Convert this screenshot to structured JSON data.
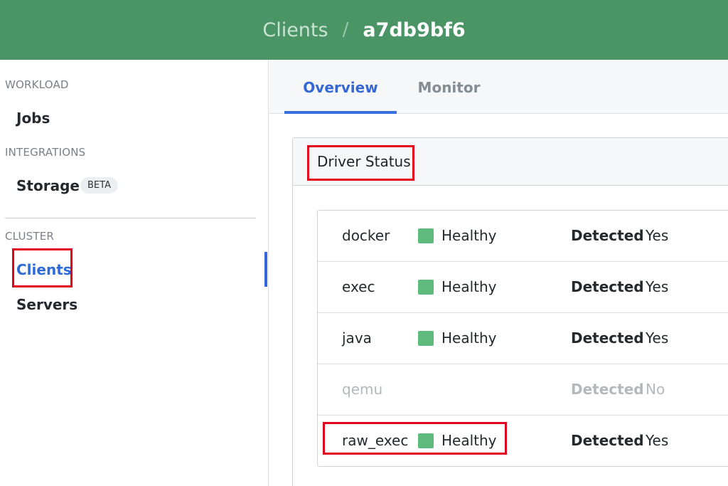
{
  "header": {
    "breadcrumb_parent": "Clients",
    "breadcrumb_separator": "/",
    "breadcrumb_current": "a7db9bf6",
    "background_color": "#4a9466"
  },
  "sidebar": {
    "sections": [
      {
        "label": "WORKLOAD",
        "items": [
          {
            "label": "Jobs"
          }
        ]
      },
      {
        "label": "INTEGRATIONS",
        "items": [
          {
            "label": "Storage",
            "badge": "BETA"
          }
        ]
      },
      {
        "label": "CLUSTER",
        "items": [
          {
            "label": "Clients",
            "active": true
          },
          {
            "label": "Servers"
          }
        ]
      }
    ]
  },
  "tabs": [
    {
      "label": "Overview",
      "active": true
    },
    {
      "label": "Monitor",
      "active": false
    }
  ],
  "driver_status": {
    "title": "Driver Status",
    "health_color": "#5fba7d",
    "rows": [
      {
        "name": "docker",
        "health": "Healthy",
        "detected_label": "Detected",
        "detected": "Yes"
      },
      {
        "name": "exec",
        "health": "Healthy",
        "detected_label": "Detected",
        "detected": "Yes"
      },
      {
        "name": "java",
        "health": "Healthy",
        "detected_label": "Detected",
        "detected": "Yes"
      },
      {
        "name": "qemu",
        "health": "",
        "detected_label": "Detected",
        "detected": "No"
      },
      {
        "name": "raw_exec",
        "health": "Healthy",
        "detected_label": "Detected",
        "detected": "Yes"
      }
    ]
  }
}
